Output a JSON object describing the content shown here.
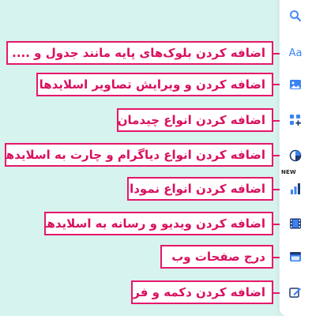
{
  "colors": {
    "background": "#d6f3ed",
    "callout_border": "#e6176b",
    "callout_text": "#d9105f",
    "icon_blue": "#3b82f6",
    "icon_dark": "#1f3b73"
  },
  "toolbar": {
    "items": [
      {
        "icon": "search-icon"
      },
      {
        "icon": "text-blocks-icon",
        "glyph": "Aa"
      },
      {
        "icon": "image-icon"
      },
      {
        "icon": "layout-add-icon"
      },
      {
        "icon": "diagram-chart-icon",
        "badge": "NEW"
      },
      {
        "icon": "bar-chart-icon"
      },
      {
        "icon": "video-media-icon"
      },
      {
        "icon": "web-page-icon"
      },
      {
        "icon": "button-form-icon"
      }
    ]
  },
  "callouts": [
    "اضافه کردن بلوک‌های پایه مانند جدول و ....",
    "اضافه کردن و ویرایش تصاویر اسلایدها",
    "اضافه کردن انواع چیدمان",
    "اضافه کردن انواع دیاگرام و چارت به اسلایدها",
    "اضافه کردن انواع نمودار",
    "اضافه کردن ویدیو و رسانه به اسلایدها",
    "درج صفحات وب",
    "اضافه کردن دکمه و فرم"
  ]
}
